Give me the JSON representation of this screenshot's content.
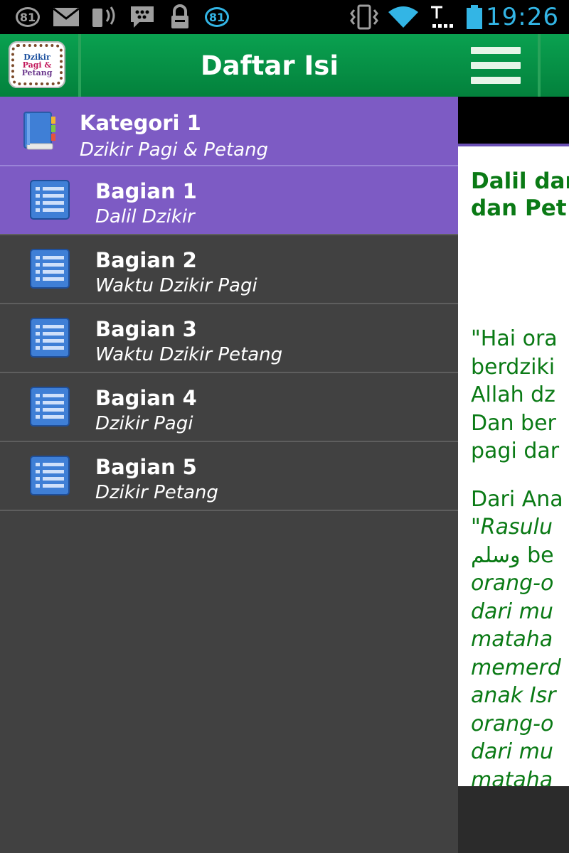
{
  "status_bar": {
    "time": "19:26",
    "badge_left": "81",
    "badge_right": "81",
    "icons": [
      "notification-badge-icon",
      "mail-icon",
      "signal-broadcast-icon",
      "bbm-icon",
      "lock-icon",
      "notification-badge-icon",
      "vibrate-icon",
      "wifi-icon",
      "cell-signal-icon",
      "battery-icon"
    ]
  },
  "drawer": {
    "title": "Daftar Isi",
    "app_logo": {
      "line1": "Dzikir",
      "line2": "Pagi &",
      "line3": "Petang"
    },
    "category": {
      "title": "Kategori 1",
      "subtitle": "Dzikir Pagi & Petang",
      "icon": "book-icon"
    },
    "items": [
      {
        "title": "Bagian 1",
        "subtitle": "Dalil Dzikir",
        "selected": true,
        "icon": "list-icon"
      },
      {
        "title": "Bagian 2",
        "subtitle": "Waktu Dzikir Pagi",
        "selected": false,
        "icon": "list-icon"
      },
      {
        "title": "Bagian 3",
        "subtitle": "Waktu Dzikir Petang",
        "selected": false,
        "icon": "list-icon"
      },
      {
        "title": "Bagian 4",
        "subtitle": "Dzikir Pagi",
        "selected": false,
        "icon": "list-icon"
      },
      {
        "title": "Bagian 5",
        "subtitle": "Dzikir Petang",
        "selected": false,
        "icon": "list-icon"
      }
    ]
  },
  "content": {
    "menu_icon": "hamburger-menu-icon",
    "heading": [
      "Dalil dar",
      "dan Pet"
    ],
    "paragraph1": [
      "\"Hai ora",
      "berdziki",
      "Allah dz",
      "Dan ber",
      "pagi dar"
    ],
    "paragraph2_first": "Dari Ana",
    "paragraph2_rest": [
      "\"Rasulu",
      "وسلم be",
      "orang-o",
      "dari mu",
      "mataha",
      "memerd",
      "anak Isr",
      "orang-o",
      "dari mu",
      "mataha"
    ]
  },
  "colors": {
    "green_bar": "#0aa150",
    "purple_selected": "#7d5bc4",
    "drawer_bg": "#414141",
    "text_green": "#0a7a15",
    "status_blue": "#33b5e5"
  }
}
